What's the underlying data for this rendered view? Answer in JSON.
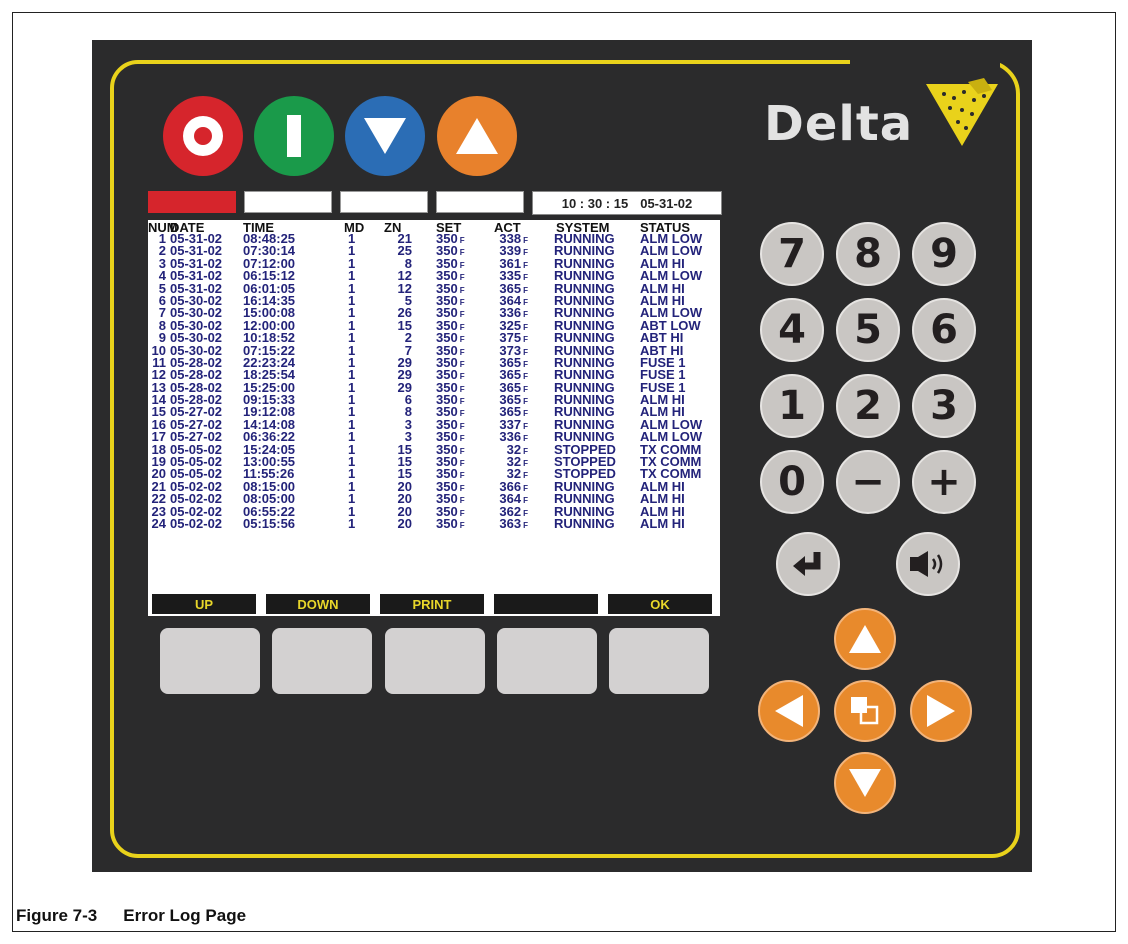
{
  "brand": {
    "name": "Delta"
  },
  "clock": {
    "time": "10 : 30 : 15",
    "date": "05-31-02"
  },
  "table": {
    "headers": [
      "NUM",
      "DATE",
      "TIME",
      "MD",
      "ZN",
      "SET",
      "ACT",
      "SYSTEM",
      "STATUS"
    ],
    "unit": "F",
    "rows": [
      [
        "1",
        "05-31-02",
        "08:48:25",
        "1",
        "21",
        "350",
        "338",
        "RUNNING",
        "ALM LOW"
      ],
      [
        "2",
        "05-31-02",
        "07:30:14",
        "1",
        "25",
        "350",
        "339",
        "RUNNING",
        "ALM LOW"
      ],
      [
        "3",
        "05-31-02",
        "07:12:00",
        "1",
        "8",
        "350",
        "361",
        "RUNNING",
        "ALM HI"
      ],
      [
        "4",
        "05-31-02",
        "06:15:12",
        "1",
        "12",
        "350",
        "335",
        "RUNNING",
        "ALM LOW"
      ],
      [
        "5",
        "05-31-02",
        "06:01:05",
        "1",
        "12",
        "350",
        "365",
        "RUNNING",
        "ALM HI"
      ],
      [
        "6",
        "05-30-02",
        "16:14:35",
        "1",
        "5",
        "350",
        "364",
        "RUNNING",
        "ALM HI"
      ],
      [
        "7",
        "05-30-02",
        "15:00:08",
        "1",
        "26",
        "350",
        "336",
        "RUNNING",
        "ALM LOW"
      ],
      [
        "8",
        "05-30-02",
        "12:00:00",
        "1",
        "15",
        "350",
        "325",
        "RUNNING",
        "ABT LOW"
      ],
      [
        "9",
        "05-30-02",
        "10:18:52",
        "1",
        "2",
        "350",
        "375",
        "RUNNING",
        "ABT HI"
      ],
      [
        "10",
        "05-30-02",
        "07:15:22",
        "1",
        "7",
        "350",
        "373",
        "RUNNING",
        "ABT HI"
      ],
      [
        "11",
        "05-28-02",
        "22:23:24",
        "1",
        "29",
        "350",
        "365",
        "RUNNING",
        "FUSE 1"
      ],
      [
        "12",
        "05-28-02",
        "18:25:54",
        "1",
        "29",
        "350",
        "365",
        "RUNNING",
        "FUSE 1"
      ],
      [
        "13",
        "05-28-02",
        "15:25:00",
        "1",
        "29",
        "350",
        "365",
        "RUNNING",
        "FUSE 1"
      ],
      [
        "14",
        "05-28-02",
        "09:15:33",
        "1",
        "6",
        "350",
        "365",
        "RUNNING",
        "ALM HI"
      ],
      [
        "15",
        "05-27-02",
        "19:12:08",
        "1",
        "8",
        "350",
        "365",
        "RUNNING",
        "ALM HI"
      ],
      [
        "16",
        "05-27-02",
        "14:14:08",
        "1",
        "3",
        "350",
        "337",
        "RUNNING",
        "ALM LOW"
      ],
      [
        "17",
        "05-27-02",
        "06:36:22",
        "1",
        "3",
        "350",
        "336",
        "RUNNING",
        "ALM LOW"
      ],
      [
        "18",
        "05-05-02",
        "15:24:05",
        "1",
        "15",
        "350",
        "32",
        "STOPPED",
        "TX COMM"
      ],
      [
        "19",
        "05-05-02",
        "13:00:55",
        "1",
        "15",
        "350",
        "32",
        "STOPPED",
        "TX COMM"
      ],
      [
        "20",
        "05-05-02",
        "11:55:26",
        "1",
        "15",
        "350",
        "32",
        "STOPPED",
        "TX COMM"
      ],
      [
        "21",
        "05-02-02",
        "08:15:00",
        "1",
        "20",
        "350",
        "366",
        "RUNNING",
        "ALM HI"
      ],
      [
        "22",
        "05-02-02",
        "08:05:00",
        "1",
        "20",
        "350",
        "364",
        "RUNNING",
        "ALM HI"
      ],
      [
        "23",
        "05-02-02",
        "06:55:22",
        "1",
        "20",
        "350",
        "362",
        "RUNNING",
        "ALM HI"
      ],
      [
        "24",
        "05-02-02",
        "05:15:56",
        "1",
        "20",
        "350",
        "363",
        "RUNNING",
        "ALM HI"
      ]
    ]
  },
  "softkeys": [
    "UP",
    "DOWN",
    "PRINT",
    "",
    "OK"
  ],
  "keypad": [
    "7",
    "8",
    "9",
    "4",
    "5",
    "6",
    "1",
    "2",
    "3",
    "0",
    "−",
    "+"
  ],
  "caption": {
    "figure": "Figure 7-3",
    "title": "Error Log Page"
  },
  "colors": {
    "panel": "#2b2b2c",
    "accent": "#e9d21b",
    "stop": "#d6252c",
    "start": "#1a9a4a",
    "down": "#2b6db5",
    "up": "#e8812c"
  }
}
